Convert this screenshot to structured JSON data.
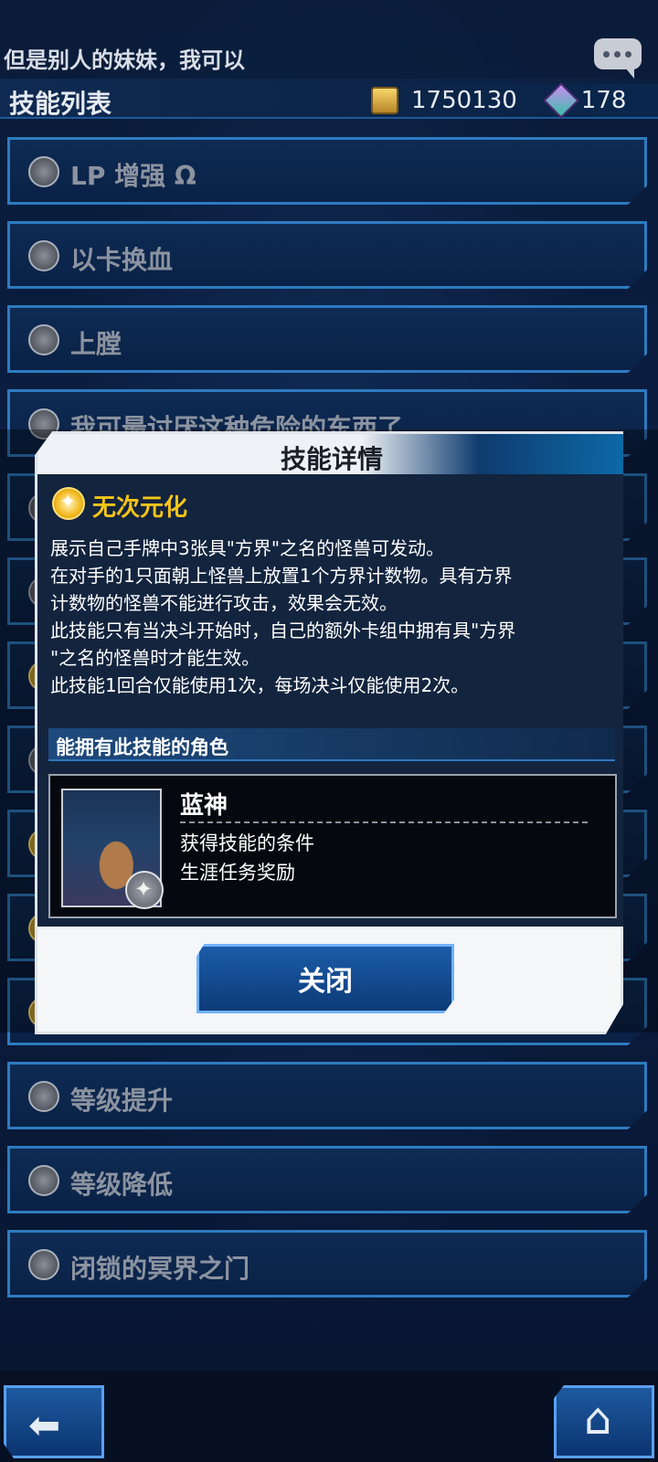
{
  "chat": {
    "text": "但是别人的妹妹，我可以",
    "icon": "chat-bubble-icon"
  },
  "header": {
    "title": "技能列表"
  },
  "currency": {
    "coins": "1750130",
    "gems": "178",
    "coin_icon": "coin-stack-icon",
    "gem_icon": "gem-icon"
  },
  "skills": [
    {
      "label": "LP 增强 Ω",
      "icon": "gray-star-icon"
    },
    {
      "label": "以卡换血",
      "icon": "gray-star-icon"
    },
    {
      "label": "上膛",
      "icon": "gray-star-icon"
    },
    {
      "label": "我可最讨厌这种危险的东西了",
      "icon": "gray-star-icon"
    },
    {
      "label": "",
      "icon": "gray-star-icon"
    },
    {
      "label": "",
      "icon": "gray-star-icon"
    },
    {
      "label": "",
      "icon": "gold-star-icon"
    },
    {
      "label": "",
      "icon": "gray-star-icon"
    },
    {
      "label": "",
      "icon": "gold-star-icon"
    },
    {
      "label": "",
      "icon": "gold-star-icon"
    },
    {
      "label": "",
      "icon": "gold-star-icon"
    },
    {
      "label": "等级提升",
      "icon": "gray-star-icon"
    },
    {
      "label": "等级降低",
      "icon": "gray-star-icon"
    },
    {
      "label": "闭锁的冥界之门",
      "icon": "gray-star-icon"
    }
  ],
  "modal": {
    "title": "技能详情",
    "skill_name": "无次元化",
    "description": [
      "展示自己手牌中3张具\"方界\"之名的怪兽可发动。",
      "在对手的1只面朝上怪兽上放置1个方界计数物。具有方界",
      "计数物的怪兽不能进行攻击，效果会无效。",
      "此技能只有当决斗开始时，自己的额外卡组中拥有具\"方界",
      "\"之名的怪兽时才能生效。",
      "此技能1回合仅能使用1次，每场决斗仅能使用2次。"
    ],
    "section_title": "能拥有此技能的角色",
    "character": {
      "name": "蓝神",
      "condition_label": "获得技能的条件",
      "condition_value": "生涯任务奖励"
    },
    "close_label": "关闭"
  },
  "footer": {
    "back_icon": "back-arrow-icon",
    "home_icon": "home-icon"
  },
  "colors": {
    "accent": "#2d7bc0",
    "skill_name": "#f5c518",
    "modal_body": "#13243e"
  }
}
